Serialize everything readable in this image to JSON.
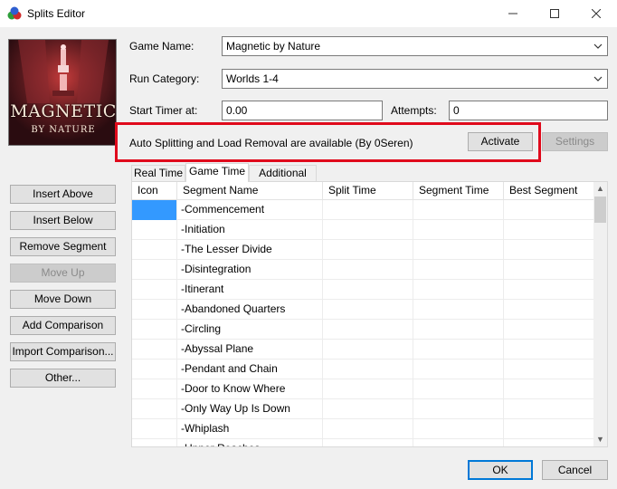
{
  "window": {
    "title": "Splits Editor",
    "minimize_icon": "minimize-icon",
    "maximize_icon": "maximize-icon",
    "close_icon": "close-icon"
  },
  "cover_art": {
    "title_line1": "MAGNETIC",
    "title_line2": "BY NATURE"
  },
  "form": {
    "game_name_label": "Game Name:",
    "game_name_value": "Magnetic by Nature",
    "run_category_label": "Run Category:",
    "run_category_value": "Worlds 1-4",
    "start_timer_label": "Start Timer at:",
    "start_timer_value": "0.00",
    "attempts_label": "Attempts:",
    "attempts_value": "0"
  },
  "autosplit": {
    "message": "Auto Splitting and Load Removal are available (By 0Seren)",
    "activate_label": "Activate",
    "settings_label": "Settings"
  },
  "side_buttons": {
    "insert_above": "Insert Above",
    "insert_below": "Insert Below",
    "remove_segment": "Remove Segment",
    "move_up": "Move Up",
    "move_down": "Move Down",
    "add_comparison": "Add Comparison",
    "import_comparison": "Import Comparison...",
    "other": "Other..."
  },
  "tabs": [
    "Real Time",
    "Game Time",
    "Additional Info"
  ],
  "active_tab": "Game Time",
  "table": {
    "columns": [
      "Icon",
      "Segment Name",
      "Split Time",
      "Segment Time",
      "Best Segment"
    ],
    "rows": [
      "-Commencement",
      "-Initiation",
      "-The Lesser Divide",
      "-Disintegration",
      "-Itinerant",
      "-Abandoned Quarters",
      "-Circling",
      "-Abyssal Plane",
      "-Pendant and Chain",
      "-Door to Know Where",
      "-Only Way Up Is Down",
      "-Whiplash",
      "-Upper Reaches"
    ],
    "selected_color": "#3399ff"
  },
  "footer": {
    "ok_label": "OK",
    "cancel_label": "Cancel"
  },
  "colors": {
    "highlight_box": "#e00a1c",
    "accent": "#0078d7"
  }
}
